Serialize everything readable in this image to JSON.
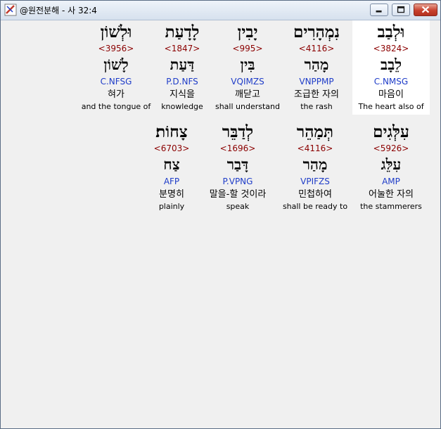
{
  "window": {
    "title": "@원전분해 - 사 32:4"
  },
  "lines": [
    {
      "words": [
        {
          "hebrew": "וּלְבַב",
          "strong": "<3824>",
          "lemma": "לֵבָב",
          "morph": "C.NMSG",
          "korean": "마음이",
          "english": "The heart also of",
          "selected": true
        },
        {
          "hebrew": "נִמְהָרִים",
          "strong": "<4116>",
          "lemma": "מָהַר",
          "morph": "VNPPMP",
          "korean": "조급한 자의",
          "english": "the rash",
          "selected": false
        },
        {
          "hebrew": "יָבִין",
          "strong": "<995>",
          "lemma": "בִּין",
          "morph": "VQIMZS",
          "korean": "깨닫고",
          "english": "shall understand",
          "selected": false
        },
        {
          "hebrew": "לָדָעַת",
          "strong": "<1847>",
          "lemma": "דַּעַת",
          "morph": "P.D.NFS",
          "korean": "지식을",
          "english": "knowledge",
          "selected": false
        },
        {
          "hebrew": "וּלְשׁוֹן",
          "strong": "<3956>",
          "lemma": "לָשׁוֹן",
          "morph": "C.NFSG",
          "korean": "혀가",
          "english": "and the tongue of",
          "selected": false
        }
      ]
    },
    {
      "words": [
        {
          "hebrew": "עִלְּגִים",
          "strong": "<5926>",
          "lemma": "עִלֵּג",
          "morph": "AMP",
          "korean": "어눌한 자의",
          "english": "the stammerers",
          "selected": false
        },
        {
          "hebrew": "תְּמַהֵר",
          "strong": "<4116>",
          "lemma": "מָהַר",
          "morph": "VPIFZS",
          "korean": "민첩하여",
          "english": "shall be ready to",
          "selected": false
        },
        {
          "hebrew": "לְדַבֵּר",
          "strong": "<1696>",
          "lemma": "דָּבַר",
          "morph": "P.VPNG",
          "korean": "말을-할 것이라",
          "english": "speak",
          "selected": false
        },
        {
          "hebrew": "צָחוֹת׃",
          "strong": "<6703>",
          "lemma": "צַח",
          "morph": "AFP",
          "korean": "분명히",
          "english": "plainly",
          "selected": false
        }
      ]
    }
  ]
}
